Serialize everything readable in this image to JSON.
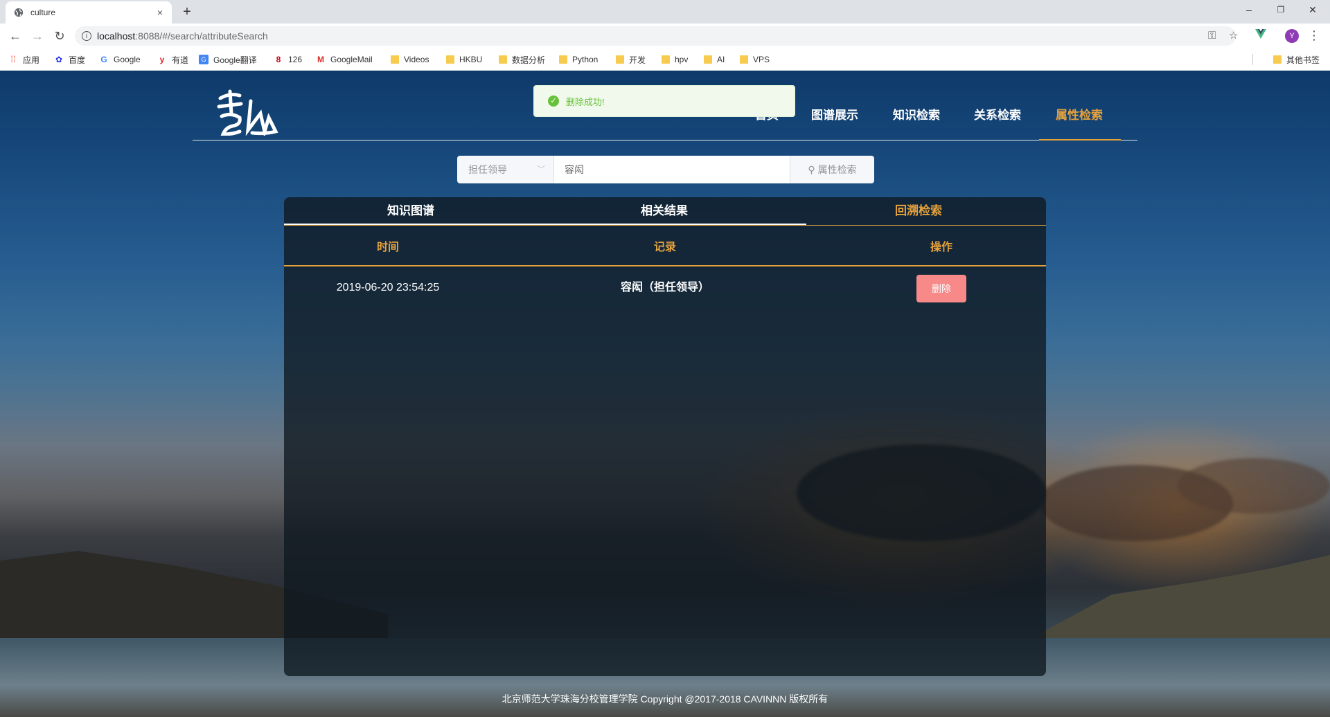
{
  "browser": {
    "tab_title": "culture",
    "tab_close": "×",
    "new_tab": "+",
    "url_host": "localhost",
    "url_path": ":8088/#/search/attributeSearch",
    "window_controls": {
      "minimize": "–",
      "restore": "❐",
      "close": "✕"
    },
    "avatar_letter": "Y",
    "bookmarks": [
      {
        "label": "应用",
        "icon": "apps-grid-icon"
      },
      {
        "label": "百度",
        "icon": "baidu-paw-icon"
      },
      {
        "label": "Google",
        "icon": "google-g-icon"
      },
      {
        "label": "有道",
        "icon": "youdao-icon"
      },
      {
        "label": "Google翻译",
        "icon": "google-translate-icon"
      },
      {
        "label": "126",
        "icon": "netease-126-icon"
      },
      {
        "label": "GoogleMail",
        "icon": "gmail-icon"
      },
      {
        "label": "Videos",
        "icon": "folder-icon"
      },
      {
        "label": "HKBU",
        "icon": "folder-icon"
      },
      {
        "label": "数据分析",
        "icon": "folder-icon"
      },
      {
        "label": "Python",
        "icon": "folder-icon"
      },
      {
        "label": "开发",
        "icon": "folder-icon"
      },
      {
        "label": "hpv",
        "icon": "folder-icon"
      },
      {
        "label": "AI",
        "icon": "folder-icon"
      },
      {
        "label": "VPS",
        "icon": "folder-icon"
      }
    ],
    "other_bookmarks": "其他书签"
  },
  "header": {
    "nav": [
      {
        "label": "图谱展示",
        "active": false
      },
      {
        "label": "知识检索",
        "active": false
      },
      {
        "label": "关系检索",
        "active": false
      },
      {
        "label": "属性检索",
        "active": true
      }
    ],
    "hidden_nav_fragment": "首页"
  },
  "toast": {
    "message": "删除成功!",
    "type": "success"
  },
  "search": {
    "select_value": "担任领导",
    "input_value": "容闳",
    "button_label": "属性检索"
  },
  "tabs": [
    {
      "label": "知识图谱",
      "active": false
    },
    {
      "label": "相关结果",
      "active": false
    },
    {
      "label": "回溯检索",
      "active": true
    }
  ],
  "table": {
    "headers": [
      "时间",
      "记录",
      "操作"
    ],
    "rows": [
      {
        "time": "2019-06-20 23:54:25",
        "record": "容闳（担任领导）",
        "action": "删除"
      }
    ]
  },
  "footer": "北京师范大学珠海分校管理学院 Copyright @2017-2018 CAVINNN 版权所有",
  "colors": {
    "accent": "#e6a23c",
    "success": "#67c23a",
    "danger_button": "#f78989"
  }
}
